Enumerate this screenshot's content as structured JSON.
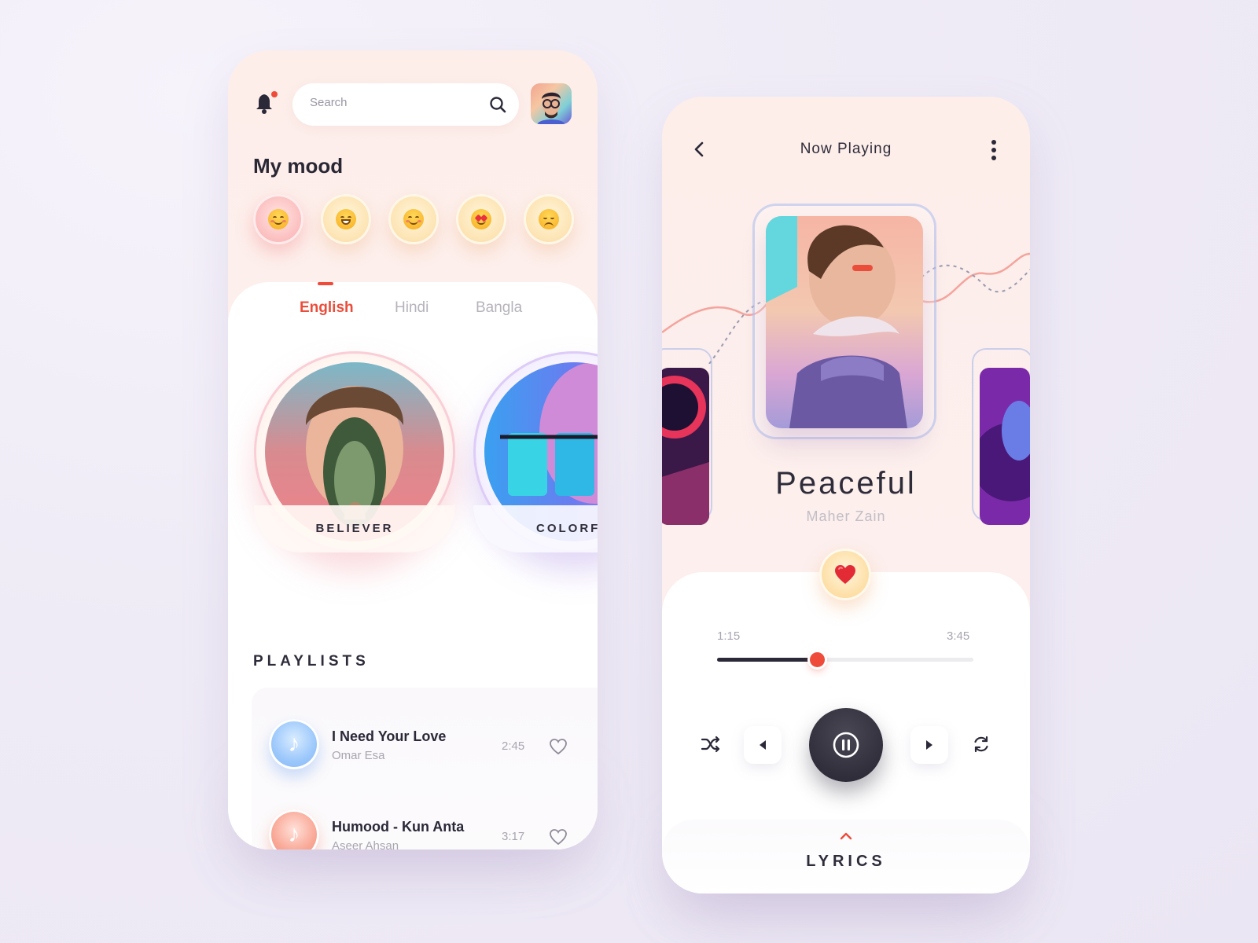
{
  "left_screen": {
    "search": {
      "placeholder": "Search"
    },
    "mood": {
      "title": "My mood",
      "items": [
        {
          "icon": "smiling-face-emoji",
          "active": true
        },
        {
          "icon": "grinning-face-emoji",
          "active": false
        },
        {
          "icon": "blushing-face-emoji",
          "active": false
        },
        {
          "icon": "heart-eyes-emoji",
          "active": false
        },
        {
          "icon": "sad-face-emoji",
          "active": false
        }
      ]
    },
    "tabs": [
      {
        "label": "English",
        "active": true
      },
      {
        "label": "Hindi",
        "active": false
      },
      {
        "label": "Bangla",
        "active": false
      }
    ],
    "albums": [
      {
        "label": "BELIEVER"
      },
      {
        "label": "COLORF"
      }
    ],
    "playlists": {
      "title": "PLAYLISTS",
      "tracks": [
        {
          "title": "I Need Your Love",
          "artist": "Omar Esa",
          "duration": "2:45",
          "icon_color": "blue"
        },
        {
          "title": "Humood - Kun Anta",
          "artist": "Aseer Ahsan",
          "duration": "3:17",
          "icon_color": "pink"
        }
      ]
    }
  },
  "right_screen": {
    "header": {
      "title": "Now Playing"
    },
    "song": {
      "title": "Peaceful",
      "artist": "Maher Zain"
    },
    "progress": {
      "current": "1:15",
      "total": "3:45",
      "fraction": 0.39
    },
    "lyrics": {
      "label": "LYRICS"
    }
  },
  "colors": {
    "accent": "#ef4b3a",
    "text_dark": "#2b2838",
    "text_muted": "#a9a5b0",
    "tab_active": "#ea4e3b"
  }
}
